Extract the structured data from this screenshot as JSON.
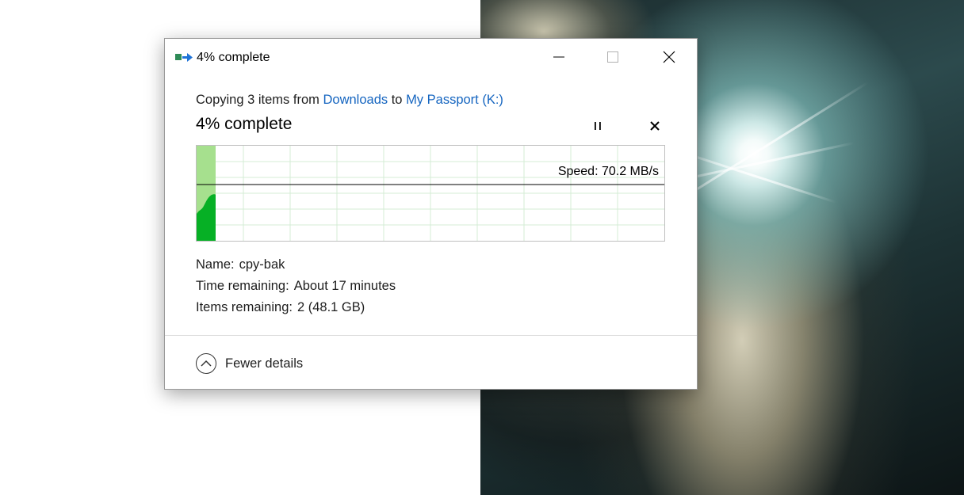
{
  "window": {
    "title": "4% complete",
    "minimize_icon": "minimize-icon",
    "maximize_icon": "maximize-icon",
    "close_icon": "close-icon"
  },
  "copy": {
    "prefix": "Copying 3 items from ",
    "source": "Downloads",
    "mid": " to ",
    "destination": "My Passport (K:)"
  },
  "status": {
    "percent_text": "4% complete",
    "progress_fraction": 0.04,
    "pause_icon": "pause-icon",
    "cancel_icon": "cancel-icon"
  },
  "graph": {
    "speed_text": "Speed: 70.2 MB/s",
    "fill_color": "#a6e08e",
    "speed_color": "#06b025",
    "grid_color": "#d4ecd6"
  },
  "details": {
    "name_label": "Name:",
    "name_value": "cpy-bak",
    "time_label": "Time remaining:",
    "time_value": "About 17 minutes",
    "items_label": "Items remaining:",
    "items_value": "2 (48.1 GB)"
  },
  "footer": {
    "toggle_label": "Fewer details",
    "toggle_icon": "chevron-up-icon"
  }
}
